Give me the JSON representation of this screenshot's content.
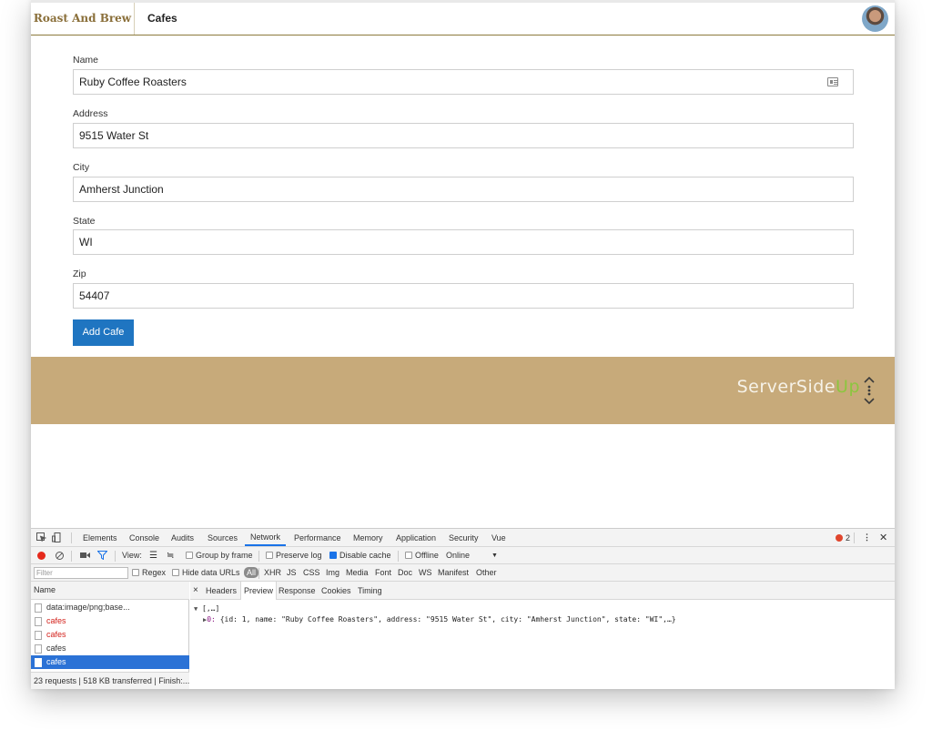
{
  "header": {
    "brand": "Roast And Brew",
    "nav_item": "Cafes"
  },
  "form": {
    "fields": [
      {
        "label": "Name",
        "value": "Ruby Coffee Roasters"
      },
      {
        "label": "Address",
        "value": "9515 Water St"
      },
      {
        "label": "City",
        "value": "Amherst Junction"
      },
      {
        "label": "State",
        "value": "WI"
      },
      {
        "label": "Zip",
        "value": "54407"
      }
    ],
    "submit_label": "Add Cafe"
  },
  "footer": {
    "logo_main": "ServerSide",
    "logo_accent": "Up"
  },
  "devtools": {
    "tabs": [
      "Elements",
      "Console",
      "Audits",
      "Sources",
      "Network",
      "Performance",
      "Memory",
      "Application",
      "Security",
      "Vue"
    ],
    "active_tab": "Network",
    "error_count": "2",
    "toolbar": {
      "view_label": "View:",
      "group_by_frame": "Group by frame",
      "preserve_log": "Preserve log",
      "disable_cache": "Disable cache",
      "offline": "Offline",
      "throttle": "Online"
    },
    "filter_placeholder": "Filter",
    "filter_options": {
      "regex": "Regex",
      "hide_data_urls": "Hide data URLs",
      "all": "All"
    },
    "type_filters": [
      "XHR",
      "JS",
      "CSS",
      "Img",
      "Media",
      "Font",
      "Doc",
      "WS",
      "Manifest",
      "Other"
    ],
    "requests_header": "Name",
    "requests": [
      {
        "name": "data:image/png;base...",
        "status": "normal"
      },
      {
        "name": "cafes",
        "status": "error"
      },
      {
        "name": "cafes",
        "status": "error"
      },
      {
        "name": "cafes",
        "status": "normal"
      },
      {
        "name": "cafes",
        "status": "selected"
      }
    ],
    "status_bar": "23 requests | 518 KB transferred | Finish:...",
    "detail_tabs": [
      "Headers",
      "Preview",
      "Response",
      "Cookies",
      "Timing"
    ],
    "active_detail_tab": "Preview",
    "preview": {
      "root": "[,…]",
      "item_index": "0:",
      "item": "{id: 1, name: \"Ruby Coffee Roasters\", address: \"9515 Water St\", city: \"Amherst Junction\", state: \"WI\",…}"
    }
  }
}
